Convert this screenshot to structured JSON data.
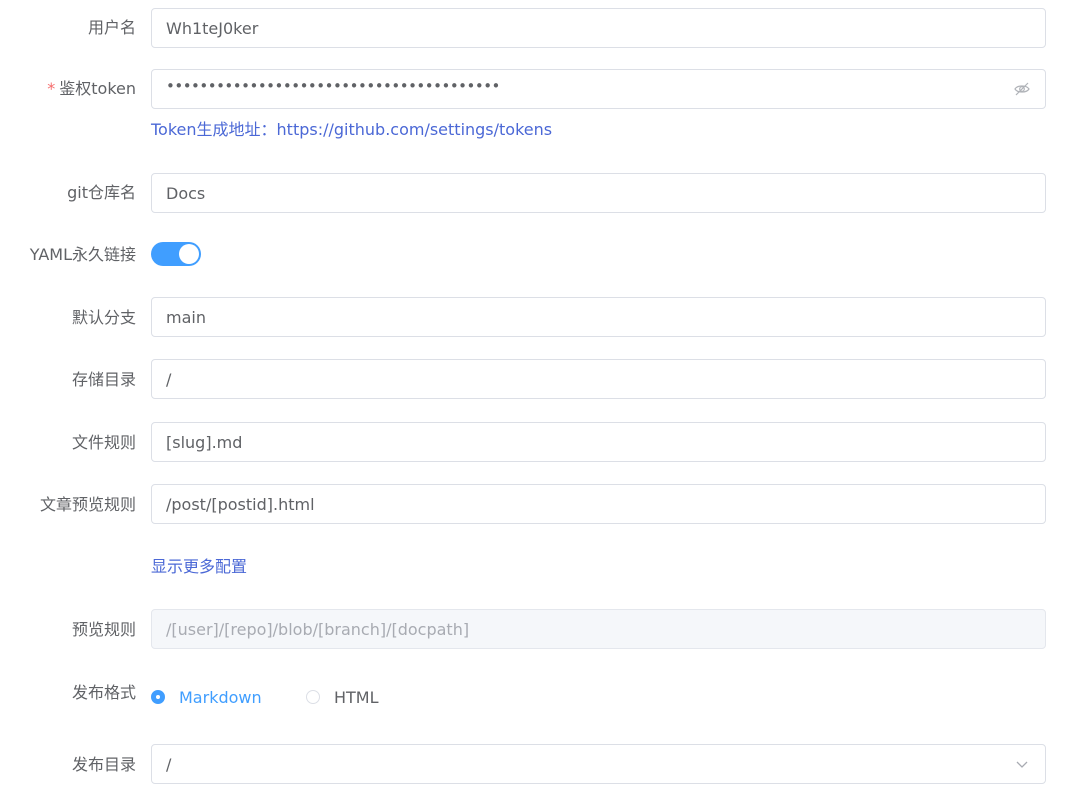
{
  "form": {
    "username": {
      "label": "用户名",
      "value": "Wh1teJ0ker"
    },
    "token": {
      "required_mark": "*",
      "label": "鉴权token",
      "value_masked": "••••••••••••••••••••••••••••••••••••••••",
      "icon": "eye-off-icon"
    },
    "token_help": "Token生成地址：https://github.com/settings/tokens",
    "repo": {
      "label": "git仓库名",
      "value": "Docs"
    },
    "yaml": {
      "label": "YAML永久链接",
      "enabled": true
    },
    "branch": {
      "label": "默认分支",
      "value": "main"
    },
    "storage_dir": {
      "label": "存储目录",
      "value": "/"
    },
    "file_rule": {
      "label": "文件规则",
      "value": "[slug].md"
    },
    "post_preview_rule": {
      "label": "文章预览规则",
      "value": "/post/[postid].html"
    },
    "show_more": "显示更多配置",
    "preview_rule": {
      "label": "预览规则",
      "placeholder": "/[user]/[repo]/blob/[branch]/[docpath]"
    },
    "publish_format": {
      "label": "发布格式",
      "options": [
        "Markdown",
        "HTML"
      ],
      "selected": "Markdown"
    },
    "publish_dir": {
      "label": "发布目录",
      "value": "/",
      "icon": "chevron-down-icon"
    }
  },
  "colors": {
    "primary": "#409eff",
    "link": "#4b68d6",
    "required": "#f56c6c",
    "text": "#606266",
    "border": "#dcdfe6"
  }
}
